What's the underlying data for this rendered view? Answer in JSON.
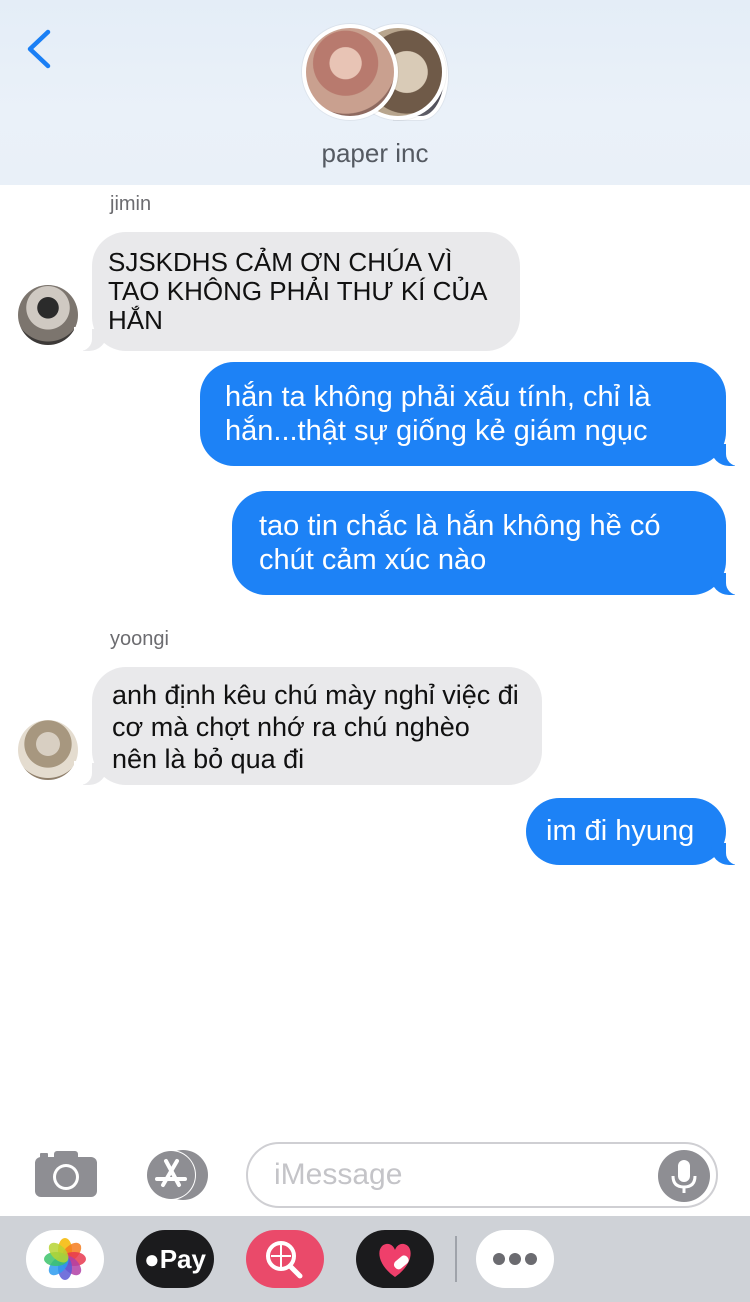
{
  "header": {
    "group_name": "paper inc",
    "back_icon": "chevron-left-icon"
  },
  "messages": [
    {
      "sender": "jimin",
      "direction": "incoming",
      "text": "SJSKDHS CẢM ƠN CHÚA VÌ TAO KHÔNG PHẢI THƯ KÍ CỦA HẮN"
    },
    {
      "direction": "outgoing",
      "text": "hắn ta không phải xấu tính, chỉ là hắn...thật sự giống kẻ giám ngục"
    },
    {
      "direction": "outgoing",
      "text": "tao tin chắc là hắn không hề có chút cảm xúc nào"
    },
    {
      "sender": "yoongi",
      "direction": "incoming",
      "text": "anh định kêu chú mày nghỉ việc đi cơ mà chợt nhớ ra chú nghèo nên là bỏ qua đi"
    },
    {
      "direction": "outgoing",
      "text": "im đi hyung"
    }
  ],
  "input_bar": {
    "placeholder": "iMessage",
    "camera_icon": "camera-icon",
    "appstore_icon": "app-store-icon",
    "mic_icon": "microphone-icon"
  },
  "app_drawer": {
    "items": [
      {
        "name": "photos-icon"
      },
      {
        "name": "apple-pay-button",
        "label": "Pay"
      },
      {
        "name": "web-search-icon"
      },
      {
        "name": "digital-touch-icon"
      },
      {
        "name": "more-icon"
      }
    ]
  },
  "colors": {
    "outgoing_bubble": "#1d82f6",
    "incoming_bubble": "#e9e9eb",
    "accent": "#1a7ff5"
  }
}
